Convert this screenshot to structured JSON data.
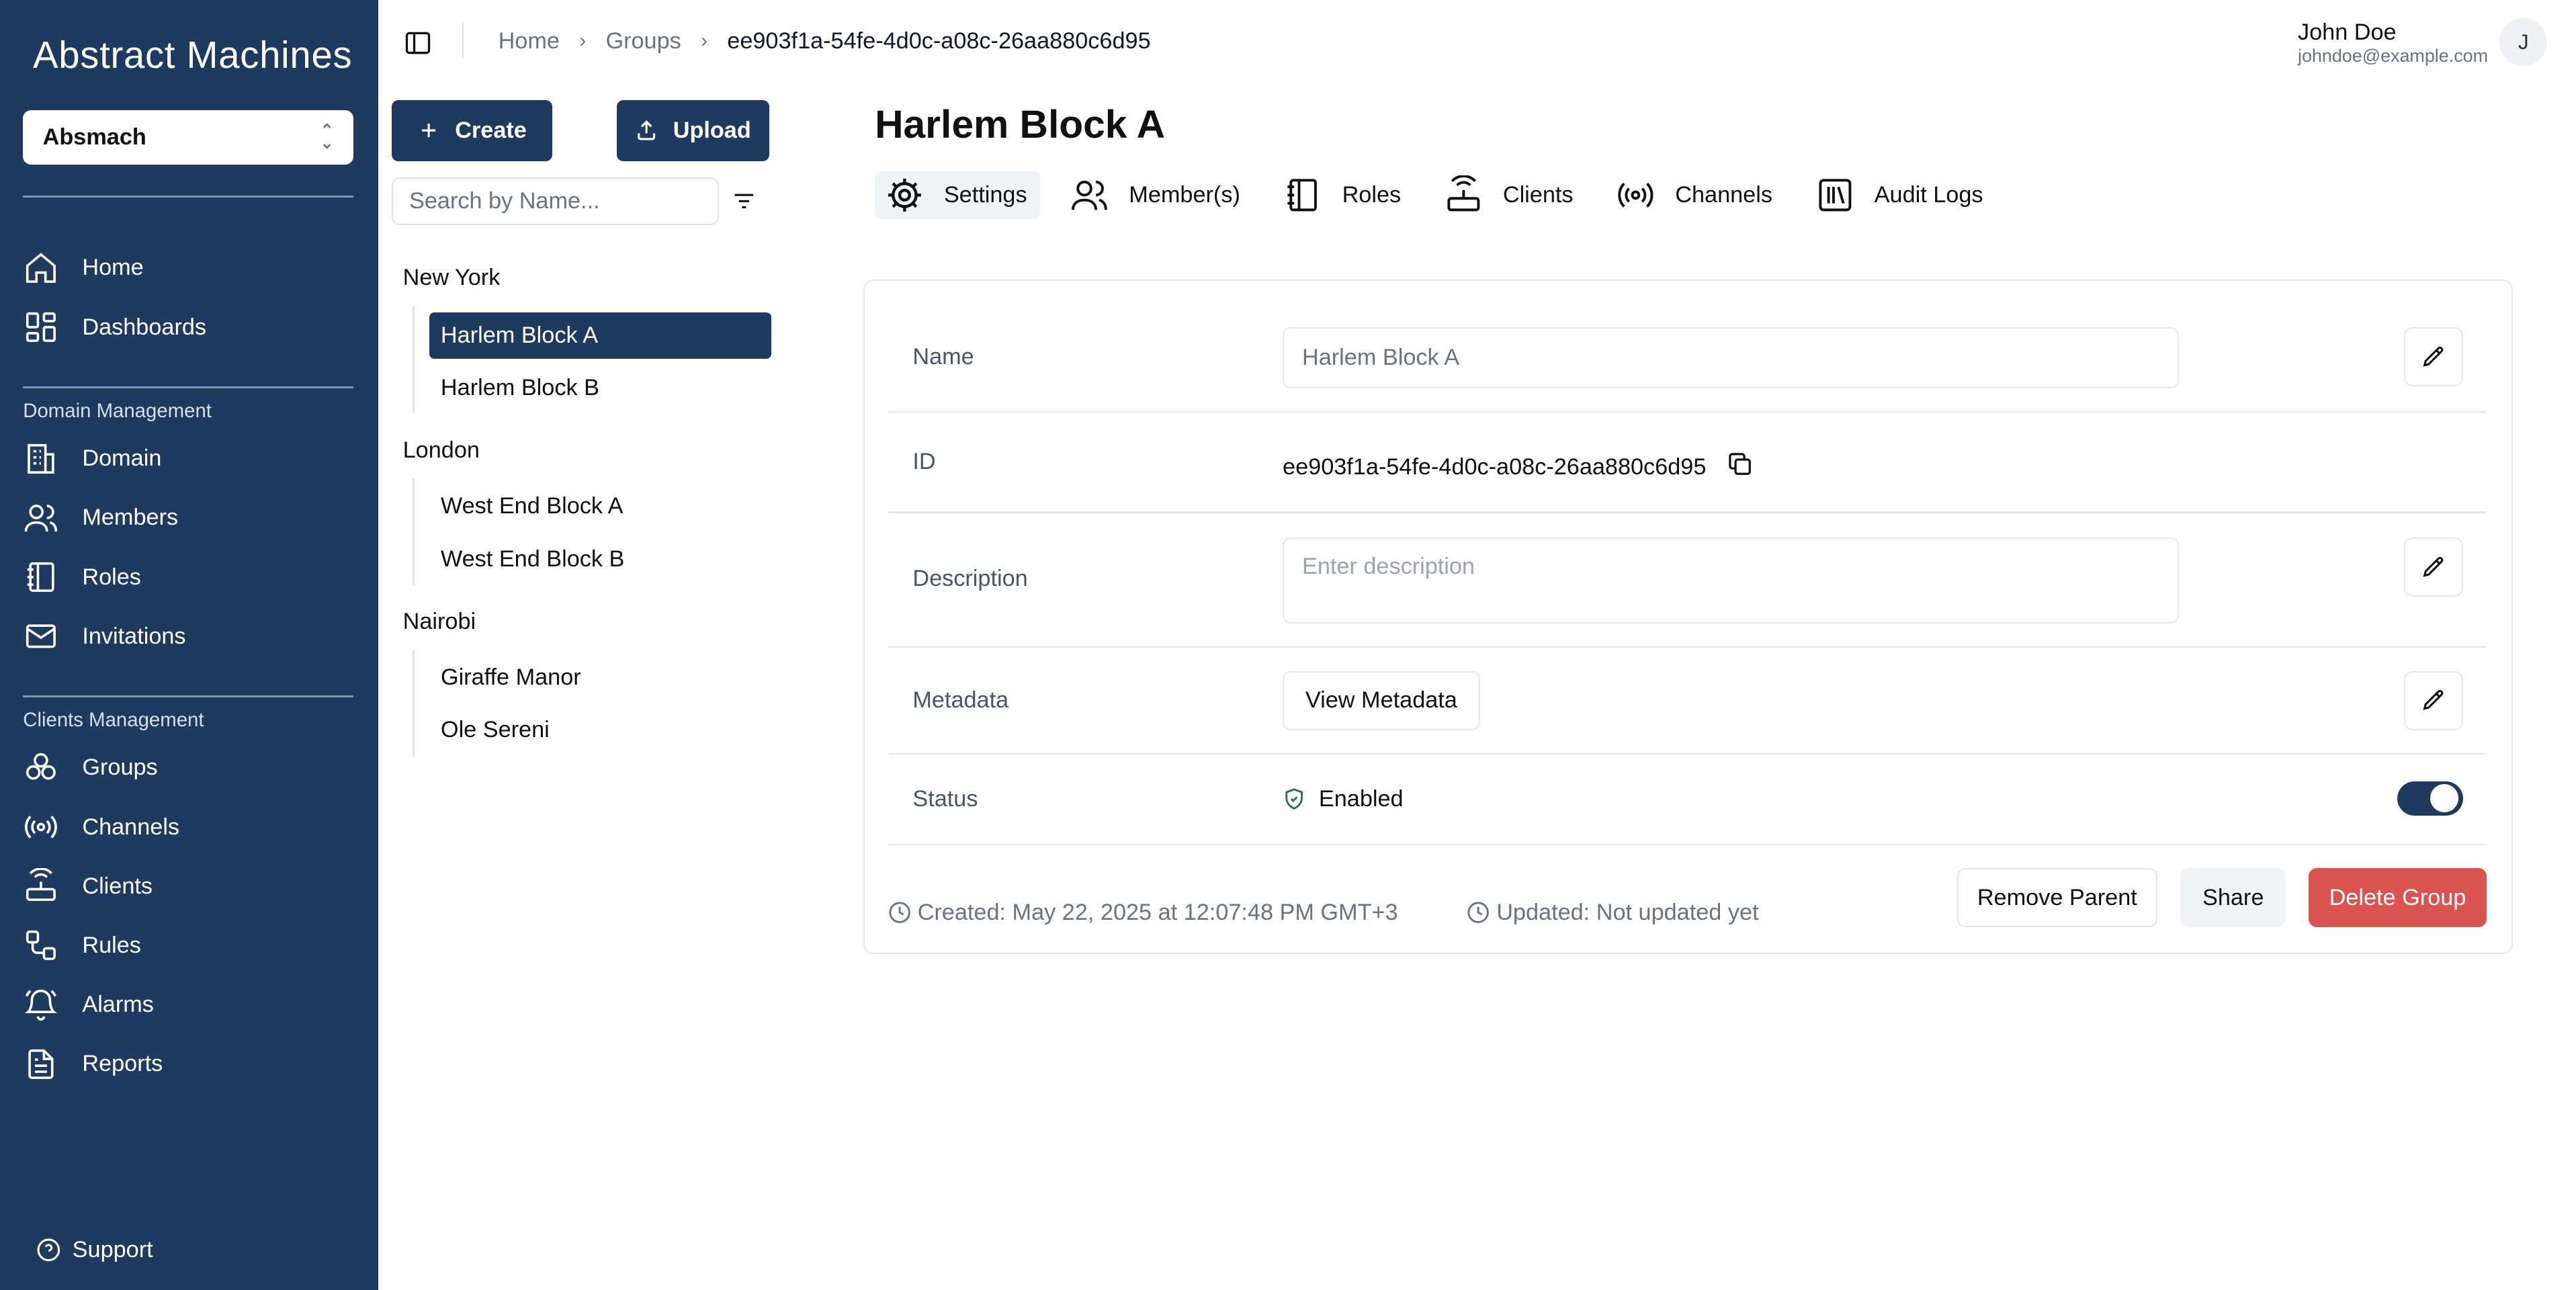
{
  "app": {
    "logo": "Abstract Machines"
  },
  "sidebar": {
    "domain_selector": "Absmach",
    "main_items": [
      {
        "label": "Home",
        "icon": "home-icon"
      },
      {
        "label": "Dashboards",
        "icon": "dashboard-icon"
      }
    ],
    "domain_section": {
      "label": "Domain Management",
      "items": [
        {
          "label": "Domain",
          "icon": "building-icon"
        },
        {
          "label": "Members",
          "icon": "users-icon"
        },
        {
          "label": "Roles",
          "icon": "notebook-icon"
        },
        {
          "label": "Invitations",
          "icon": "mail-icon"
        }
      ]
    },
    "clients_section": {
      "label": "Clients Management",
      "items": [
        {
          "label": "Groups",
          "icon": "groups-icon"
        },
        {
          "label": "Channels",
          "icon": "broadcast-icon"
        },
        {
          "label": "Clients",
          "icon": "router-icon"
        },
        {
          "label": "Rules",
          "icon": "workflow-icon"
        },
        {
          "label": "Alarms",
          "icon": "bell-icon"
        },
        {
          "label": "Reports",
          "icon": "file-icon"
        }
      ]
    },
    "support": "Support"
  },
  "breadcrumb": {
    "home": "Home",
    "groups": "Groups",
    "current": "ee903f1a-54fe-4d0c-a08c-26aa880c6d95"
  },
  "user": {
    "name": "John Doe",
    "email": "johndoe@example.com",
    "initial": "J"
  },
  "middle": {
    "create_label": "Create",
    "upload_label": "Upload",
    "search_placeholder": "Search by Name...",
    "tree": [
      {
        "group": "New York",
        "items": [
          "Harlem Block A",
          "Harlem Block B"
        ]
      },
      {
        "group": "London",
        "items": [
          "West End Block A",
          "West End Block B"
        ]
      },
      {
        "group": "Nairobi",
        "items": [
          "Giraffe Manor",
          "Ole Sereni"
        ]
      }
    ],
    "selected": "Harlem Block A"
  },
  "main": {
    "title": "Harlem Block A",
    "tabs": [
      {
        "label": "Settings",
        "icon": "gear-icon",
        "active": true
      },
      {
        "label": "Member(s)",
        "icon": "users-icon"
      },
      {
        "label": "Roles",
        "icon": "notebook-icon"
      },
      {
        "label": "Clients",
        "icon": "router-icon"
      },
      {
        "label": "Channels",
        "icon": "broadcast-icon"
      },
      {
        "label": "Audit Logs",
        "icon": "library-icon"
      }
    ],
    "fields": {
      "name_label": "Name",
      "name_value": "Harlem Block A",
      "id_label": "ID",
      "id_value": "ee903f1a-54fe-4d0c-a08c-26aa880c6d95",
      "description_label": "Description",
      "description_placeholder": "Enter description",
      "metadata_label": "Metadata",
      "view_metadata": "View Metadata",
      "status_label": "Status",
      "status_value": "Enabled"
    },
    "created": "Created: May 22, 2025 at 12:07:48 PM GMT+3",
    "updated": "Updated: Not updated yet",
    "actions": {
      "remove_parent": "Remove Parent",
      "share": "Share",
      "delete": "Delete Group"
    },
    "colors": {
      "primary": "#1e3a5f",
      "danger": "#d9534f"
    }
  }
}
